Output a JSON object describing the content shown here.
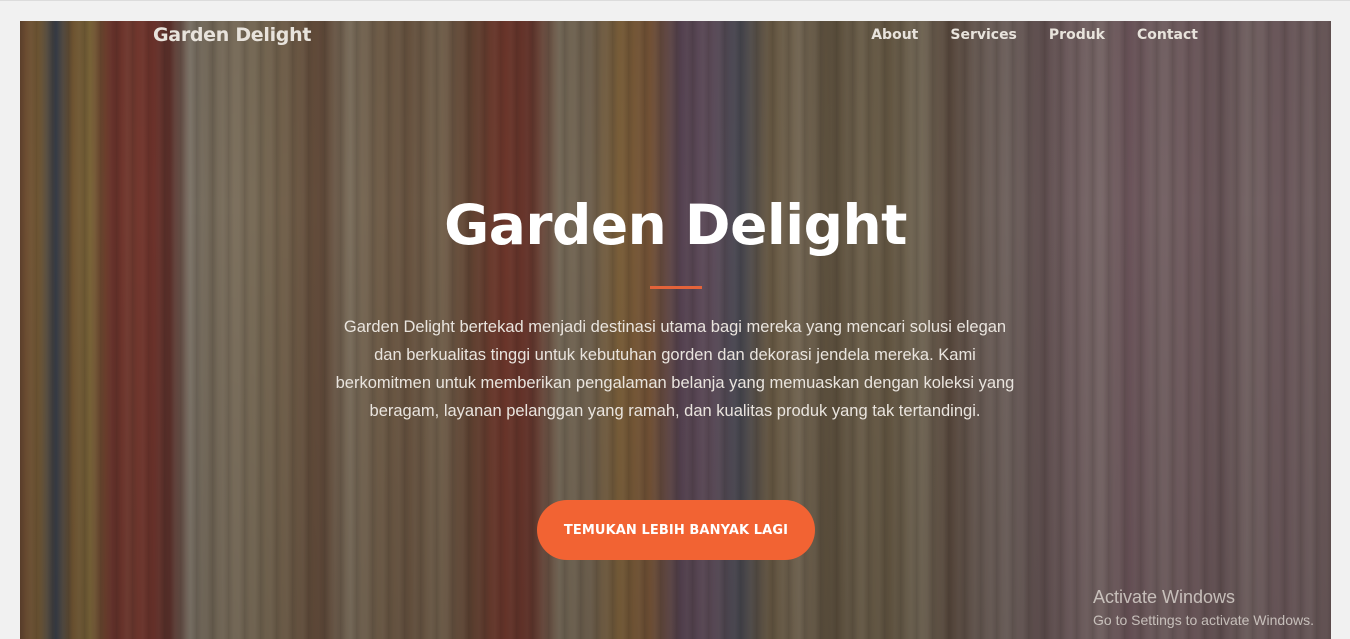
{
  "navbar": {
    "brand": "Garden Delight",
    "links": [
      {
        "label": "About"
      },
      {
        "label": "Services"
      },
      {
        "label": "Produk"
      },
      {
        "label": "Contact"
      }
    ]
  },
  "hero": {
    "title": "Garden Delight",
    "description": "Garden Delight bertekad menjadi destinasi utama bagi mereka yang mencari solusi elegan dan berkualitas tinggi untuk kebutuhan gorden dan dekorasi jendela mereka. Kami berkomitmen untuk memberikan pengalaman belanja yang memuaskan dengan koleksi yang beragam, layanan pelanggan yang ramah, dan kualitas produk yang tak tertandingi.",
    "cta_label": "TEMUKAN LEBIH BANYAK LAGI",
    "accent_color": "#f26333"
  },
  "watermark": {
    "title": "Activate Windows",
    "subtitle": "Go to Settings to activate Windows."
  }
}
